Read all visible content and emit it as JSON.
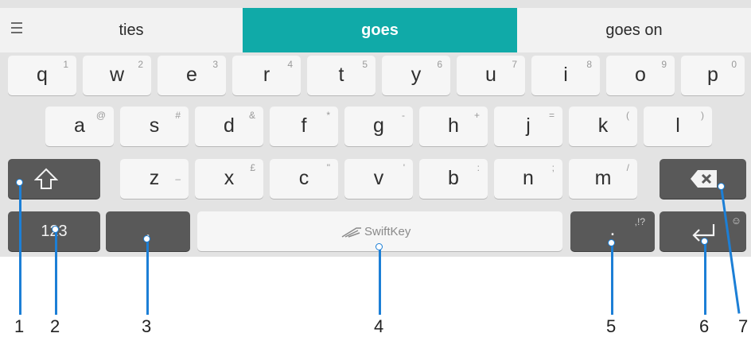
{
  "suggestions": {
    "left": "ties",
    "middle": "goes",
    "right": "goes on"
  },
  "rows": {
    "row1": [
      {
        "key": "q",
        "sec": "1"
      },
      {
        "key": "w",
        "sec": "2"
      },
      {
        "key": "e",
        "sec": "3"
      },
      {
        "key": "r",
        "sec": "4"
      },
      {
        "key": "t",
        "sec": "5"
      },
      {
        "key": "y",
        "sec": "6"
      },
      {
        "key": "u",
        "sec": "7"
      },
      {
        "key": "i",
        "sec": "8"
      },
      {
        "key": "o",
        "sec": "9"
      },
      {
        "key": "p",
        "sec": "0"
      }
    ],
    "row2": [
      {
        "key": "a",
        "sec": "@"
      },
      {
        "key": "s",
        "sec": "#"
      },
      {
        "key": "d",
        "sec": "&"
      },
      {
        "key": "f",
        "sec": "*"
      },
      {
        "key": "g",
        "sec": "-"
      },
      {
        "key": "h",
        "sec": "+"
      },
      {
        "key": "j",
        "sec": "="
      },
      {
        "key": "k",
        "sec": "("
      },
      {
        "key": "l",
        "sec": ")"
      }
    ],
    "row3": [
      {
        "key": "z",
        "sec": "–"
      },
      {
        "key": "x",
        "sec": "£"
      },
      {
        "key": "c",
        "sec": "\""
      },
      {
        "key": "v",
        "sec": "'"
      },
      {
        "key": "b",
        "sec": ":"
      },
      {
        "key": "n",
        "sec": ";"
      },
      {
        "key": "m",
        "sec": "/"
      }
    ]
  },
  "bottom": {
    "numbers": "123",
    "comma": ",",
    "space_brand": "SwiftKey",
    "period": ".",
    "period_sec": ",!?",
    "enter_sec": "☺"
  },
  "icons": {
    "shift": "shift-icon",
    "backspace": "backspace-icon",
    "enter": "enter-icon",
    "menu": "menu-icon",
    "swiftkey": "swiftkey-logo-icon"
  },
  "callouts": [
    "1",
    "2",
    "3",
    "4",
    "5",
    "6",
    "7"
  ],
  "colors": {
    "accent": "#10aaa8",
    "callout": "#1c7fd6",
    "dark_key": "#595959"
  }
}
